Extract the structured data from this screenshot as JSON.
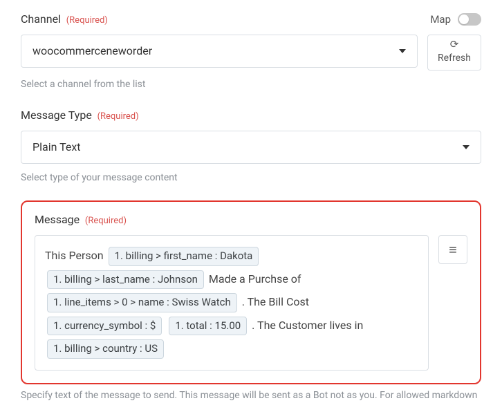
{
  "channel": {
    "label": "Channel",
    "required_text": "(Required)",
    "map_label": "Map",
    "map_on": false,
    "value": "woocommerceneworder",
    "refresh_label": "Refresh",
    "helper": "Select a channel from the list"
  },
  "message_type": {
    "label": "Message Type",
    "required_text": "(Required)",
    "value": "Plain Text",
    "helper": "Select type of your message content"
  },
  "message": {
    "label": "Message",
    "required_text": "(Required)",
    "parts": [
      {
        "type": "text",
        "value": "This Person "
      },
      {
        "type": "token",
        "value": "1. billing > first_name : Dakota"
      },
      {
        "type": "text",
        "value": " "
      },
      {
        "type": "token",
        "value": "1. billing > last_name : Johnson"
      },
      {
        "type": "text",
        "value": " Made a Purchse of "
      },
      {
        "type": "token",
        "value": "1. line_items > 0 > name : Swiss Watch"
      },
      {
        "type": "text",
        "value": " . The Bill Cost "
      },
      {
        "type": "token",
        "value": "1. currency_symbol : $"
      },
      {
        "type": "text",
        "value": " "
      },
      {
        "type": "token",
        "value": "1. total : 15.00"
      },
      {
        "type": "text",
        "value": " . The Customer lives in "
      },
      {
        "type": "token",
        "value": "1. billing > country : US"
      }
    ],
    "footer_helper": "Specify text of the message to send. This message will be sent as a Bot not as you. For allowed markdown"
  },
  "icons": {
    "caret": "caret-down-icon",
    "refresh": "refresh-icon",
    "hamburger": "hamburger-icon"
  }
}
